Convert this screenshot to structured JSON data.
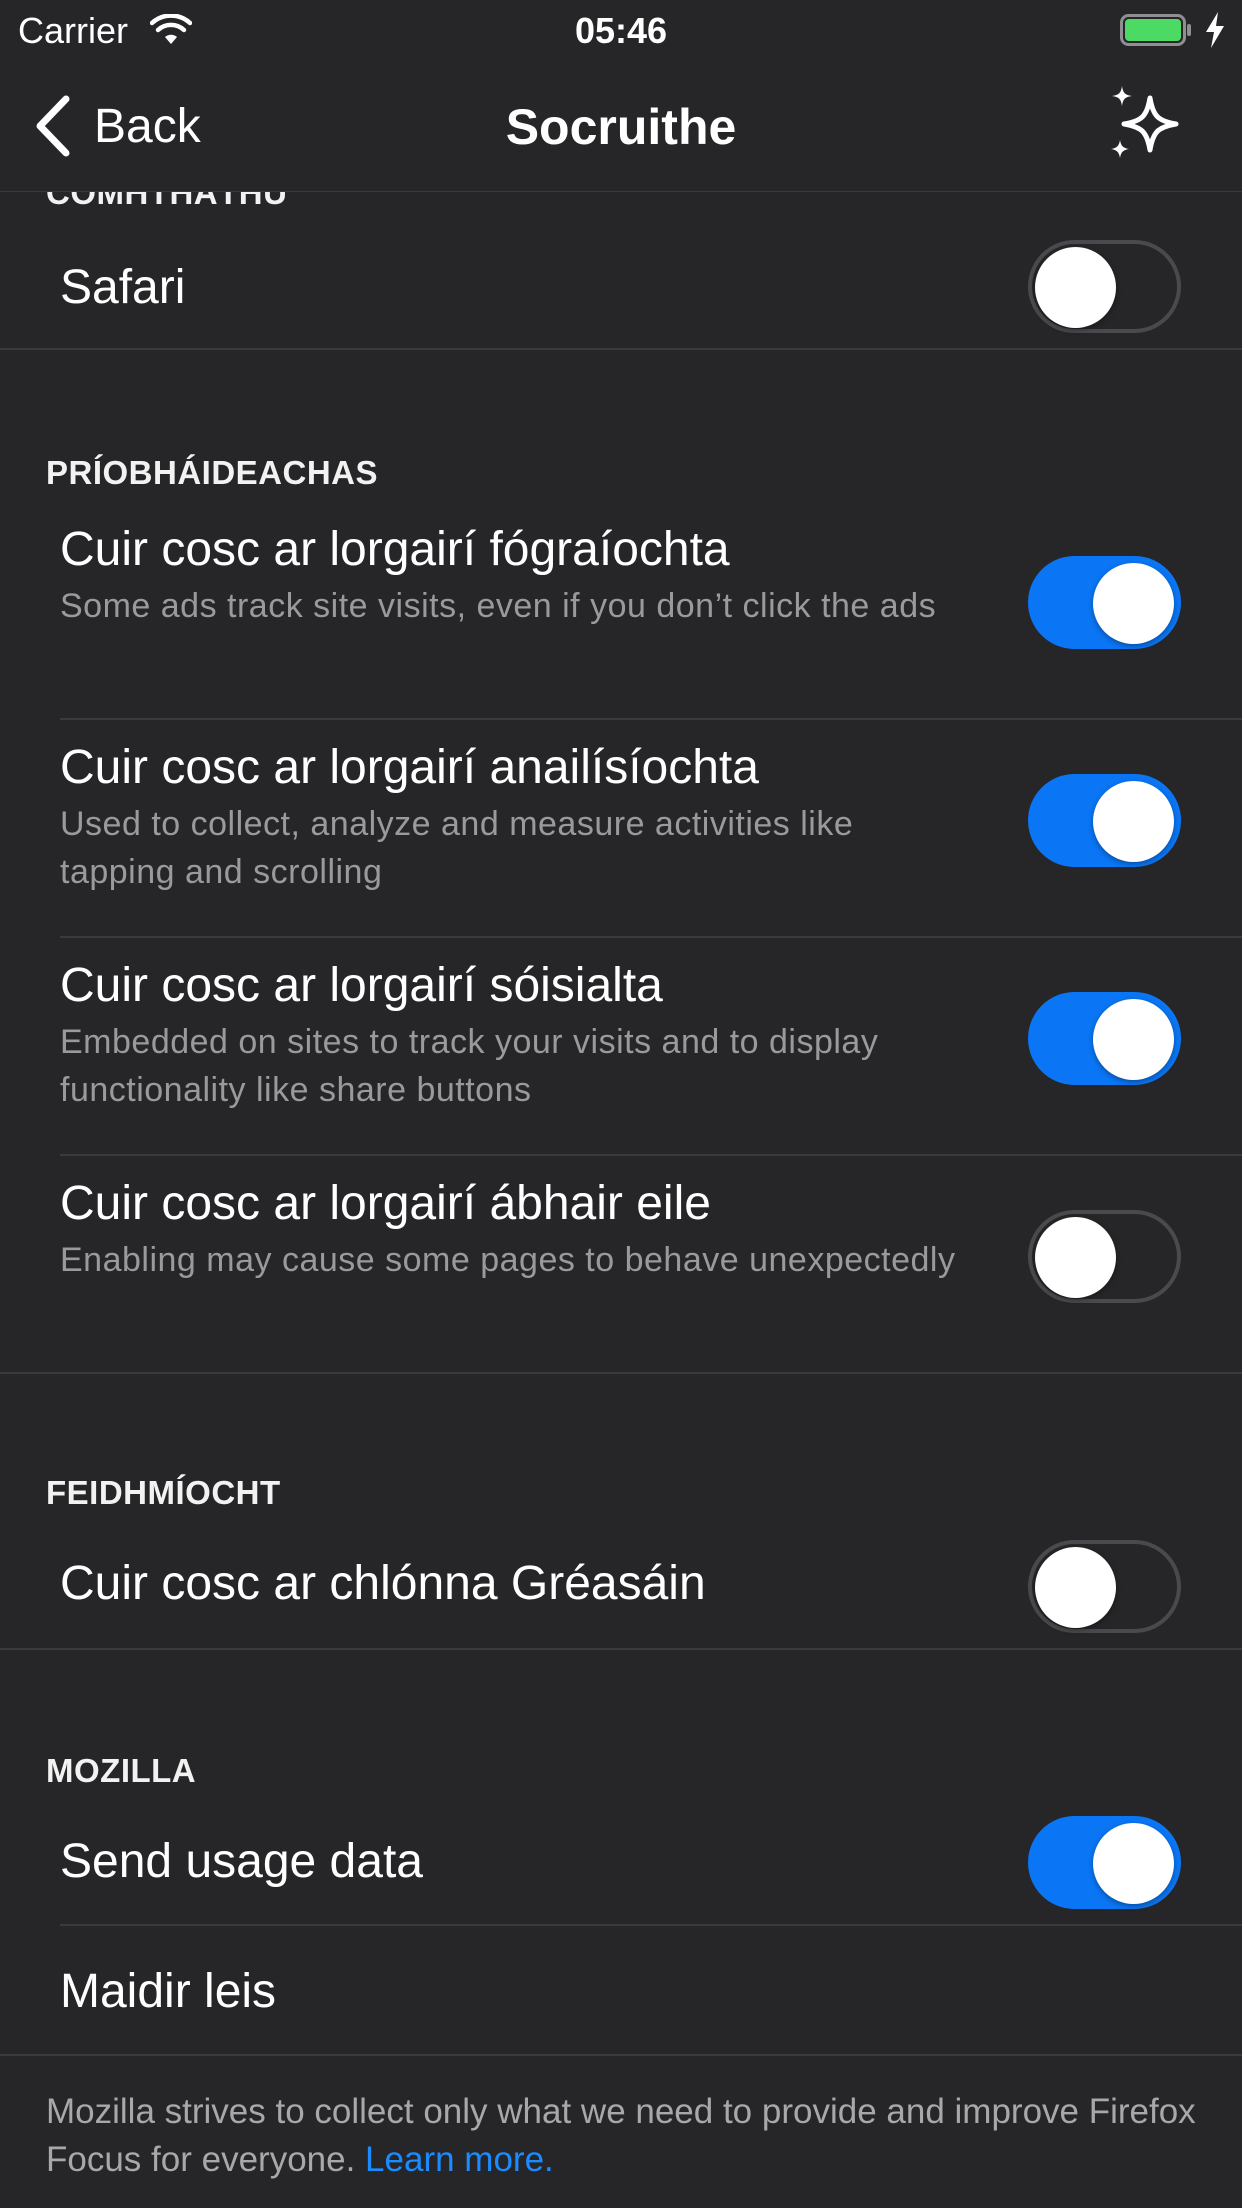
{
  "status_bar": {
    "carrier": "Carrier",
    "time": "05:46",
    "battery_color": "#4cd964"
  },
  "nav": {
    "back_label": "Back",
    "title": "Socruithe",
    "action_icon": "sparkle-icon"
  },
  "sections": {
    "integration": {
      "header": "COMHTHÁTHÚ",
      "items": [
        {
          "title": "Safari",
          "enabled": false
        }
      ]
    },
    "privacy": {
      "header": "PRÍOBHÁIDEACHAS",
      "items": [
        {
          "title": "Cuir cosc ar lorgairí fógraíochta",
          "subtitle": "Some ads track site visits, even if you don’t click the ads",
          "enabled": true
        },
        {
          "title": "Cuir cosc ar lorgairí anailísíochta",
          "subtitle": "Used to collect, analyze and measure activities like tapping and scrolling",
          "enabled": true
        },
        {
          "title": "Cuir cosc ar lorgairí sóisialta",
          "subtitle": "Embedded on sites to track your visits and to display functionality like share buttons",
          "enabled": true
        },
        {
          "title": "Cuir cosc ar lorgairí ábhair eile",
          "subtitle": "Enabling may cause some pages to behave unexpectedly",
          "enabled": false
        }
      ]
    },
    "performance": {
      "header": "FEIDHMÍOCHT",
      "items": [
        {
          "title": "Cuir cosc ar chlónna Gréasáin",
          "enabled": false
        }
      ]
    },
    "mozilla": {
      "header": "MOZILLA",
      "items": [
        {
          "title": "Send usage data",
          "enabled": true
        },
        {
          "title": "Maidir leis"
        }
      ]
    }
  },
  "footer": {
    "text": "Mozilla strives to collect only what we need to provide and improve Firefox Focus for everyone. ",
    "link": "Learn more."
  },
  "colors": {
    "background": "#262628",
    "toggle_on": "#0a76f5",
    "link": "#1a8cff"
  }
}
